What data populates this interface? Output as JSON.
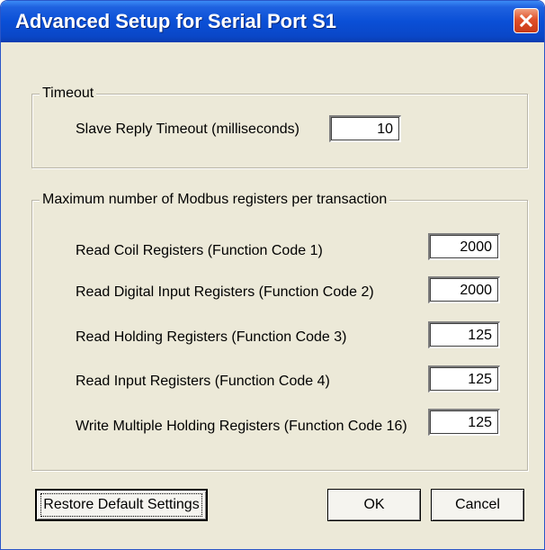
{
  "window": {
    "title": "Advanced Setup for Serial Port S1"
  },
  "icons": {
    "close": "close-icon"
  },
  "timeout_group": {
    "legend": "Timeout",
    "slave_reply_label": "Slave Reply Timeout (milliseconds)",
    "slave_reply_value": "10"
  },
  "registers_group": {
    "legend": "Maximum number of Modbus registers per transaction",
    "rows": [
      {
        "label": "Read Coil Registers (Function Code 1)",
        "value": "2000"
      },
      {
        "label": "Read Digital Input Registers (Function Code 2)",
        "value": "2000"
      },
      {
        "label": "Read Holding Registers (Function Code 3)",
        "value": "125"
      },
      {
        "label": "Read Input Registers (Function Code 4)",
        "value": "125"
      },
      {
        "label": "Write Multiple Holding Registers (Function Code 16)",
        "value": "125"
      }
    ]
  },
  "buttons": {
    "restore_defaults": "Restore Default Settings",
    "ok": "OK",
    "cancel": "Cancel"
  },
  "colors": {
    "titlebar": "#0a4fd6",
    "dialog_bg": "#ece9d8",
    "close_button": "#e0502a"
  }
}
